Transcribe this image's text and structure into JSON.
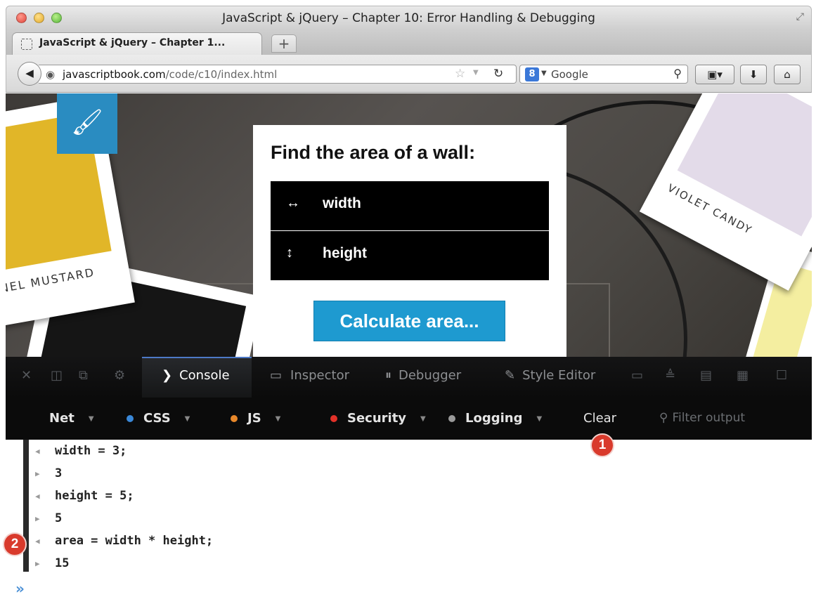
{
  "window": {
    "title": "JavaScript & jQuery – Chapter 10: Error Handling & Debugging"
  },
  "tabs": [
    {
      "label": "JavaScript & jQuery – Chapter 1..."
    }
  ],
  "navbar": {
    "url_domain": "javascriptbook.com",
    "url_path": "/code/c10/index.html",
    "search_engine_icon": "8",
    "search_placeholder": "Google"
  },
  "page": {
    "heading": "Find the area of a wall:",
    "width_icon": "↔",
    "width_label": "width",
    "height_icon": "↕",
    "height_label": "height",
    "button_label": "Calculate area...",
    "card_left_label": "ONEL MUSTARD",
    "card_right_label": "VIOLET CANDY",
    "colors": {
      "mustard": "#e1b628",
      "violet": "#e3dbe9",
      "accent": "#1e9ad0"
    }
  },
  "devtools": {
    "tabs": [
      "Console",
      "Inspector",
      "Debugger",
      "Style Editor"
    ],
    "filters": [
      {
        "label": "Net",
        "color": ""
      },
      {
        "label": "CSS",
        "color": "#3a88d8"
      },
      {
        "label": "JS",
        "color": "#e8882a"
      },
      {
        "label": "Security",
        "color": "#e23128"
      },
      {
        "label": "Logging",
        "color": "#9a9a9a"
      }
    ],
    "clear_label": "Clear",
    "filter_placeholder": "Filter output"
  },
  "console": {
    "lines": [
      {
        "type": "input",
        "text": "width = 3;"
      },
      {
        "type": "output",
        "text": "3"
      },
      {
        "type": "input",
        "text": "height = 5;"
      },
      {
        "type": "output",
        "text": "5"
      },
      {
        "type": "input",
        "text": "area = width * height;"
      },
      {
        "type": "output",
        "text": "15"
      }
    ],
    "prompt": "»"
  },
  "annotations": [
    "1",
    "2"
  ]
}
